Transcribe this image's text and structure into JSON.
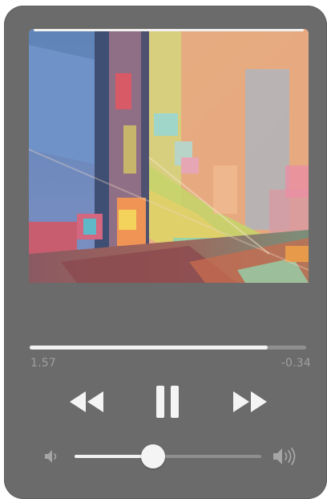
{
  "player": {
    "artwork_icon": "abstract-painting-album-art",
    "elapsed": "1.57",
    "remaining": "-0.34",
    "progress_fraction": 0.86,
    "volume_fraction": 0.42,
    "controls": {
      "rewind_icon": "rewind-icon",
      "pause_icon": "pause-icon",
      "forward_icon": "fast-forward-icon",
      "volume_low_icon": "volume-low-icon",
      "volume_high_icon": "volume-high-icon"
    },
    "colors": {
      "card": "#6b6b6b",
      "accent": "#f2f2f2",
      "track": "#8f8f8f",
      "time_text": "#9f9f9f"
    }
  }
}
